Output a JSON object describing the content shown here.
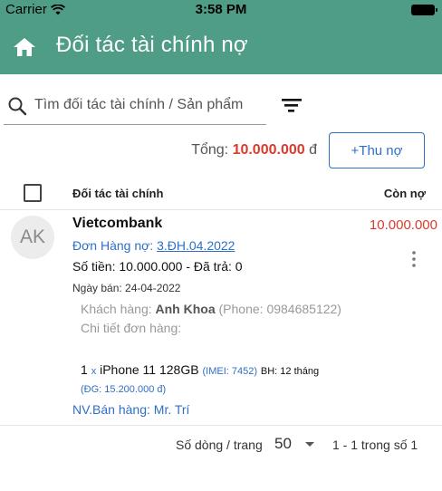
{
  "status_bar": {
    "carrier": "Carrier",
    "time": "3:58 PM"
  },
  "header": {
    "title": "Đối tác tài chính nợ"
  },
  "search": {
    "placeholder": "Tìm đối tác tài chính / Sản phẩm"
  },
  "summary": {
    "total_label": "Tổng:",
    "total_value": "10.000.000",
    "currency": "đ",
    "add_button": "+Thu nợ"
  },
  "table": {
    "headers": {
      "partner": "Đối tác tài chính",
      "remaining": "Còn nợ"
    },
    "rows": [
      {
        "avatar": "AK",
        "partner": "Vietcombank",
        "remaining": "10.000.000",
        "order_label": "Đơn Hàng nợ:",
        "order_code": "3.ĐH.04.2022",
        "money": "Số tiền: 10.000.000 - Đã trả: 0",
        "sale_date": "Ngày bán: 24-04-2022",
        "customer_label": "Khách hàng:",
        "customer_name": "Anh Khoa",
        "customer_phone": "(Phone: 0984685122)",
        "order_detail_label": "Chi tiết đơn hàng:",
        "qty": "1",
        "qty_x": "x",
        "product": "iPhone 11 128GB",
        "imei": "(IMEI: 7452)",
        "warranty": "BH: 12 tháng",
        "unit_price": "(ĐG: 15.200.000 đ)",
        "staff": "NV.Bán hàng: Mr. Trí"
      }
    ]
  },
  "pagination": {
    "rows_label": "Số dòng / trang",
    "page_size": "50",
    "range": "1 - 1 trong số 1"
  }
}
